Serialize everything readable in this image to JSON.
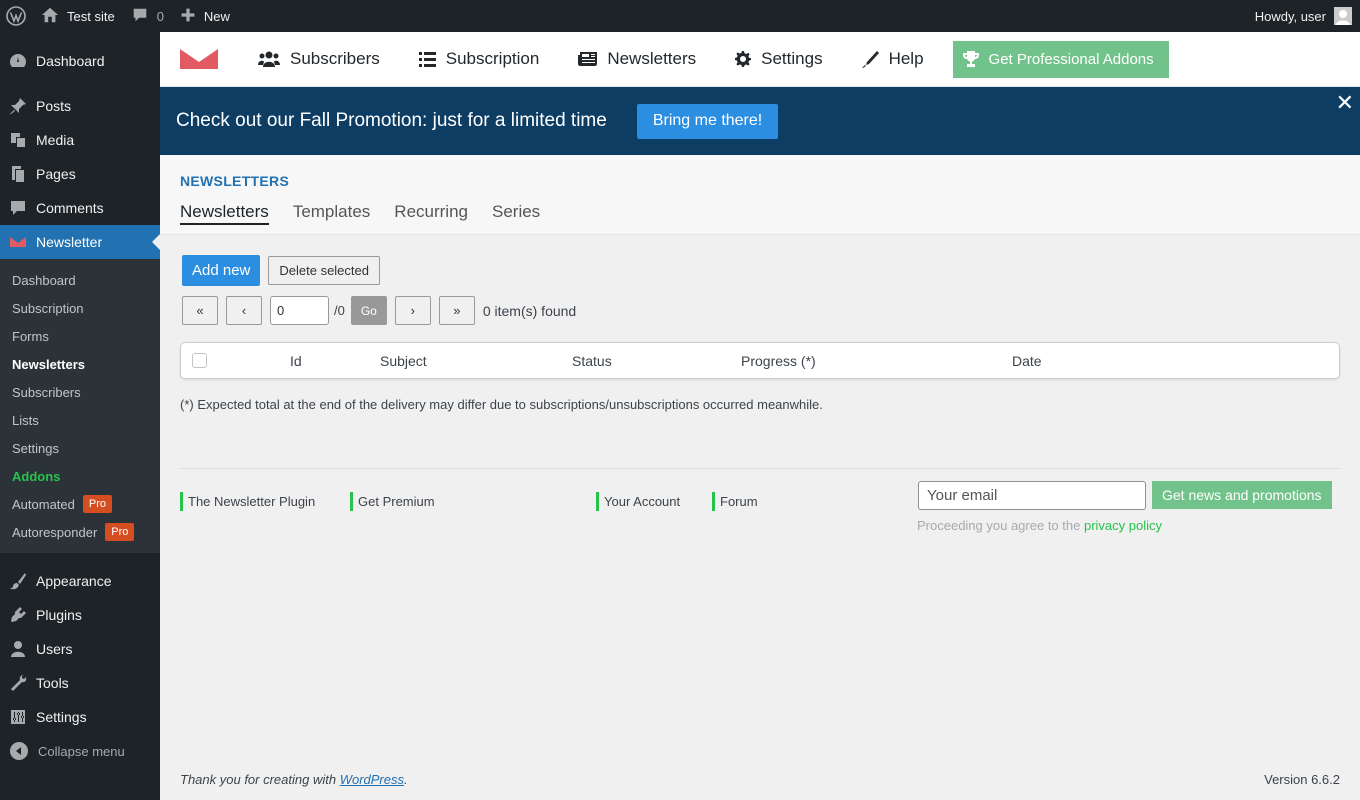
{
  "adminbar": {
    "site_name": "Test site",
    "comments_count": "0",
    "new_label": "New",
    "howdy": "Howdy, user"
  },
  "sidebar": {
    "dashboard": "Dashboard",
    "posts": "Posts",
    "media": "Media",
    "pages": "Pages",
    "comments": "Comments",
    "newsletter": "Newsletter",
    "submenu": {
      "dashboard": "Dashboard",
      "subscription": "Subscription",
      "forms": "Forms",
      "newsletters": "Newsletters",
      "subscribers": "Subscribers",
      "lists": "Lists",
      "settings": "Settings",
      "addons": "Addons",
      "automated": "Automated",
      "autoresponder": "Autoresponder",
      "pro_badge": "Pro"
    },
    "appearance": "Appearance",
    "plugins": "Plugins",
    "users": "Users",
    "tools": "Tools",
    "settings": "Settings",
    "collapse": "Collapse menu"
  },
  "header_nav": {
    "subscribers": "Subscribers",
    "subscription": "Subscription",
    "newsletters": "Newsletters",
    "settings": "Settings",
    "help": "Help",
    "pro_addons": "Get Professional Addons"
  },
  "promo": {
    "text": "Check out our Fall Promotion: just for a limited time",
    "button": "Bring me there!",
    "close": "✕"
  },
  "page": {
    "title": "NEWSLETTERS",
    "tabs": [
      "Newsletters",
      "Templates",
      "Recurring",
      "Series"
    ]
  },
  "actions": {
    "add_new": "Add new",
    "delete_selected": "Delete selected"
  },
  "pager": {
    "first": "«",
    "prev": "‹",
    "current_page": "0",
    "total": "/0",
    "go": "Go",
    "next": "›",
    "last": "»",
    "count": "0 item(s) found"
  },
  "table": {
    "columns": [
      "Id",
      "Subject",
      "Status",
      "Progress (*)",
      "Date"
    ]
  },
  "note": "(*) Expected total at the end of the delivery may differ due to subscriptions/unsubscriptions occurred meanwhile.",
  "footer_links": [
    "The Newsletter Plugin",
    "Get Premium",
    "Your Account",
    "Forum"
  ],
  "newsletter_signup": {
    "placeholder": "Your email",
    "button": "Get news and promotions",
    "privacy_prefix": "Proceeding you agree to the",
    "privacy_link": "privacy policy"
  },
  "wpfooter": {
    "thanks_prefix": "Thank you for creating with",
    "wordpress_link": "WordPress",
    "thanks_suffix": ".",
    "version": "Version 6.6.2"
  },
  "colors": {
    "accent": "#2271b1",
    "promo_bg": "#0e3d63",
    "green": "#72c38b",
    "addons_green": "#27c24c",
    "pro_badge": "#d54e21"
  }
}
